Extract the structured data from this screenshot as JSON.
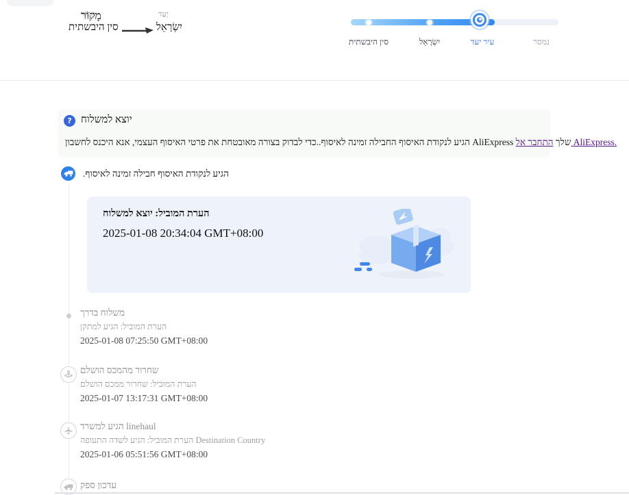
{
  "route": {
    "origin_label": "מָקוֹר",
    "origin_value": "סין היבשתית",
    "dest_label": "יָעַד",
    "dest_value": "יִשְׂרָאֵל"
  },
  "progress": {
    "stops": [
      {
        "label": "סין היבשתית",
        "state": "done"
      },
      {
        "label": "יִשְׂרָאֵל",
        "state": "done"
      },
      {
        "label": "עיר יעד",
        "state": "current"
      },
      {
        "label": "נמסר",
        "state": "future"
      }
    ]
  },
  "notice": {
    "title": "יוצא למשלוח",
    "body": "הגיע לנקודת האיסוף החבילה זמינה לאיסוף..כדי לבדוק בצורה מאובטחת את פרטי האיסוף העצמי, אנא היכנס לחשבון AliExpress שלך ",
    "link_label": "התחבר אל AliExpress."
  },
  "status": {
    "text": "הגיע לנקודת האיסוף חבילה זמינה לאיסוף."
  },
  "card": {
    "title": "הערת המוביל: יוצא למשלוח",
    "time": "2025-01-08 20:34:04 GMT+08:00"
  },
  "timeline": [
    {
      "icon": "dot-icon",
      "title": "משלוח בדרך",
      "note": "הערת המוביל: הגיע למתקן",
      "time": "2025-01-08 07:25:50 GMT+08:00"
    },
    {
      "icon": "anchor-icon",
      "title": "שחרור מהמכס הושלם",
      "note": "הערת המוביל: שחרור ממכס הושלם",
      "time": "2025-01-07 13:17:31 GMT+08:00"
    },
    {
      "icon": "airplane-icon",
      "title": "הגיע למשרד linehaul",
      "note": "הערת המוביל: הגיע לשדה התעופה Destination Country",
      "time": "2025-01-06 05:51:56 GMT+08:00"
    },
    {
      "icon": "truck-icon",
      "title": "עדכון ספק",
      "note": "",
      "time": ""
    }
  ],
  "icons": {
    "question": "?",
    "truck": "delivery-truck shape",
    "anchor": "anchor shape",
    "airplane": "airplane shape",
    "dot": "small gray dot"
  },
  "colors": {
    "accent_blue": "#2f86f1",
    "current_label_blue": "#3a7af0",
    "link_purple": "#551a8b",
    "card_background": "#edf2fb",
    "progress_track": "#eef1f8",
    "muted_gray": "#9b9b9b"
  }
}
